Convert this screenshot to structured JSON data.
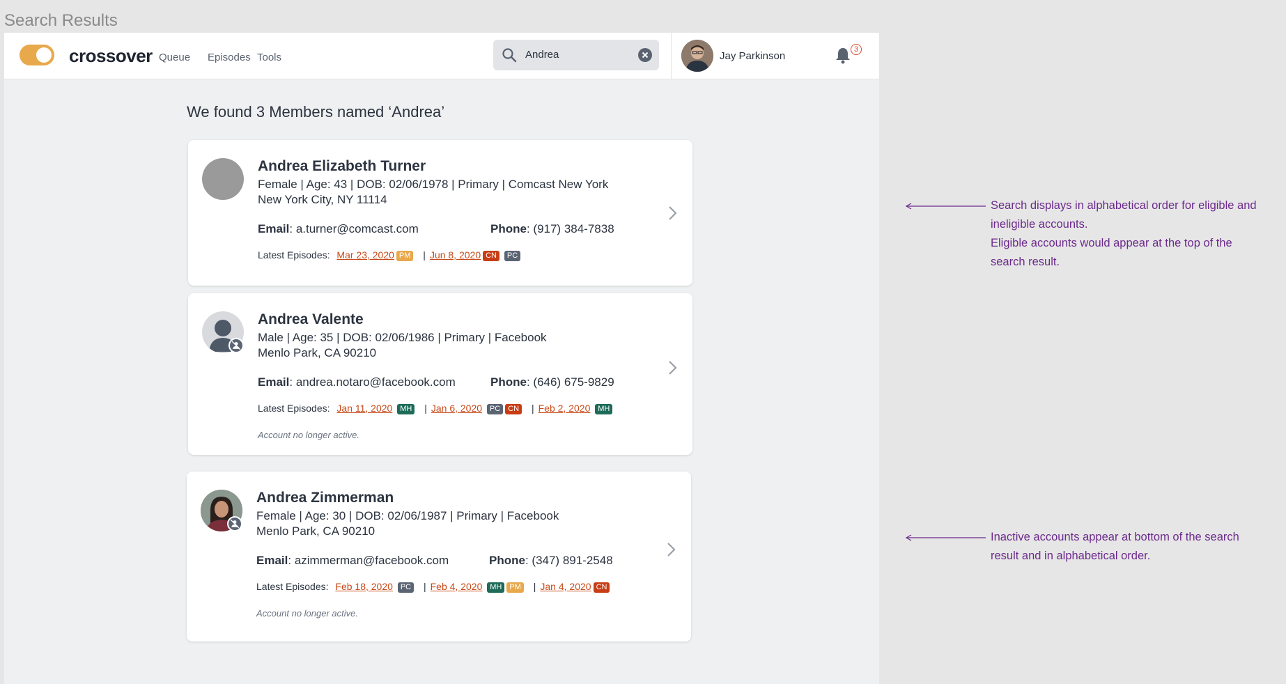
{
  "frame_title": "Search Results",
  "header": {
    "brand": "crossover",
    "nav": [
      "Queue",
      "Episodes",
      "Tools"
    ],
    "search_value": "Andrea",
    "user_name": "Jay Parkinson",
    "notification_count": "3"
  },
  "results": {
    "heading": "We found 3 Members named ‘Andrea’",
    "labels": {
      "email": "Email",
      "phone": "Phone",
      "latest_episodes": "Latest Episodes:"
    },
    "members": [
      {
        "name": "Andrea Elizabeth Turner",
        "info": "Female | Age: 43 | DOB: 02/06/1978 | Primary | Comcast New York",
        "address": "New York City, NY 11114",
        "email": "a.turner@comcast.com",
        "phone": "(917) 384-7838",
        "status": "",
        "avatar": "gray-circle",
        "episodes": [
          {
            "date": "Mar 23, 2020",
            "tags": [
              "PM"
            ]
          },
          {
            "date": "Jun 8, 2020",
            "tags": [
              "CN",
              "PC"
            ]
          }
        ]
      },
      {
        "name": "Andrea Valente",
        "info": "Male | Age: 35 | DOB: 02/06/1986 | Primary | Facebook",
        "address": "Menlo Park, CA 90210",
        "email": "andrea.notaro@facebook.com",
        "phone": "(646) 675-9829",
        "status": "Account no longer active.",
        "avatar": "person-silhouette",
        "episodes": [
          {
            "date": "Jan 11, 2020",
            "tags": [
              "MH"
            ]
          },
          {
            "date": "Jan 6, 2020",
            "tags": [
              "PC",
              "CN"
            ]
          },
          {
            "date": "Feb 2, 2020",
            "tags": [
              "MH"
            ]
          }
        ]
      },
      {
        "name": "Andrea Zimmerman",
        "info": "Female | Age: 30 | DOB: 02/06/1987 | Primary | Facebook",
        "address": "Menlo Park, CA 90210",
        "email": "azimmerman@facebook.com",
        "phone": "(347) 891-2548",
        "status": "Account no longer active.",
        "avatar": "photo",
        "episodes": [
          {
            "date": "Feb 18, 2020",
            "tags": [
              "PC"
            ]
          },
          {
            "date": "Feb 4, 2020",
            "tags": [
              "MH",
              "PM"
            ]
          },
          {
            "date": "Jan 4, 2020",
            "tags": [
              "CN"
            ]
          }
        ]
      }
    ]
  },
  "annotations": {
    "first": [
      "Search displays in alphabetical order for eligible and",
      "ineligible accounts.",
      "Eligible accounts would appear at the top of the",
      "search result."
    ],
    "second": [
      "Inactive accounts appear at bottom of the search",
      "result and in alphabetical order."
    ]
  },
  "colors": {
    "accent": "#e8a84c",
    "link": "#c84a1a",
    "annotation": "#6c2a8c",
    "PM": "#e8a84c",
    "CN": "#c83d14",
    "PC": "#5b6472",
    "MH": "#1d6b58"
  },
  "icons": [
    "search-icon",
    "clear-icon",
    "bell-icon",
    "chevron-right-icon",
    "inactive-badge-icon"
  ]
}
